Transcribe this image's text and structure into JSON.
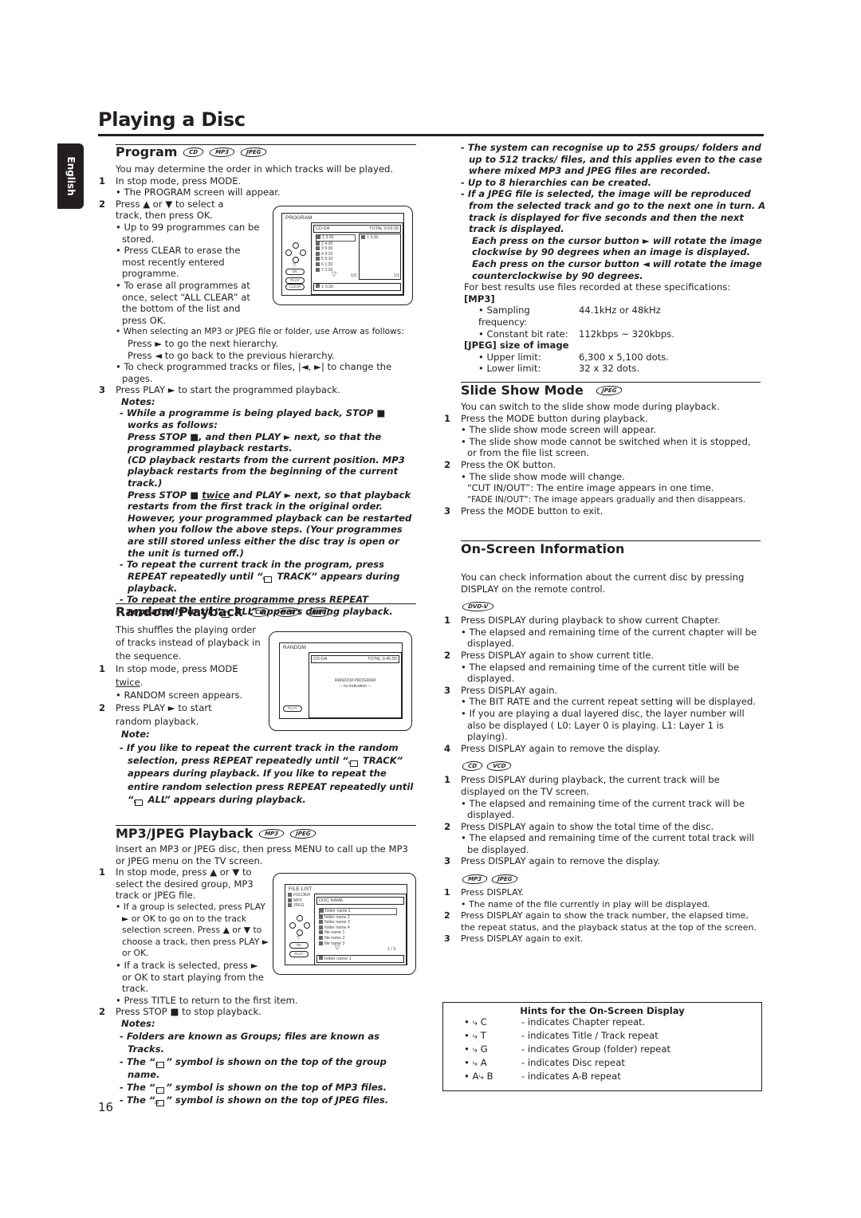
{
  "page": {
    "title": "Playing a Disc",
    "language_tab": "English",
    "page_number": "16"
  },
  "program": {
    "title": "Program",
    "discs": [
      "CD",
      "MP3",
      "JPEG"
    ],
    "intro": "You may determine the order in which tracks will be played.",
    "steps": [
      {
        "n": "1",
        "text": "In stop mode, press MODE."
      },
      {
        "n": "2",
        "text": "Press ▲ or ▼ to select a track, then press OK."
      },
      {
        "n": "3",
        "text": "Press PLAY ► to start the programmed playback."
      }
    ],
    "step1_bullets": [
      "• The PROGRAM screen will appear."
    ],
    "step2_bullets": [
      "• Up to 99 programmes can be stored.",
      "• Press CLEAR to erase the most recently entered programme.",
      "• To erase all programmes at once, select “ALL CLEAR” at the bottom of the list and press OK.",
      "• When selecting an MP3 or JPEG file or folder, use Arrow as follows:",
      "Press ► to go the next hierarchy.",
      "Press ◄ to go back to the previous hierarchy.",
      "• To check programmed tracks or files, |◄, ►| to change the pages."
    ],
    "notes_label": "Notes:",
    "notes": [
      "- While a programme is being played back, STOP ■ works as follows:",
      "Press STOP ■, and then PLAY ► next, so that the programmed playback restarts.",
      "(CD playback restarts from the current position. MP3 playback restarts from the beginning of the current track.)",
      "Press STOP ■",
      "twice",
      "and PLAY ► next, so that playback restarts from the first track in the original order. However, your programmed playback can be restarted when you follow the above steps. (Your programmes are still stored unless either the disc tray is open or the unit is turned off.)",
      "- To repeat the current track in the program, press REPEAT repeatedly until “",
      " TRACK” appears during playback.",
      "- To repeat the entire programme press REPEAT repeatedly until “",
      " ALL” appears during playback."
    ],
    "screen": {
      "label": "PROGRAM",
      "disc_type": "CD-DA",
      "total": "TOTAL  0:03:30",
      "tracks": [
        "1   3:30",
        "2   4:30",
        "3   5:00",
        "4   3:10",
        "5   5:10",
        "6   1:30",
        "7   2:30"
      ],
      "left_page": "1/2",
      "programmed": [
        "1   3:30"
      ],
      "right_page": "1/1",
      "current": "1   3:30",
      "buttons": [
        "OK",
        "PLAY",
        "CLEAR"
      ]
    }
  },
  "random": {
    "title": "Random Playback",
    "discs": [
      "CD",
      "MP3",
      "JPEG"
    ],
    "intro": "This shuffles the playing order of tracks instead of playback in the sequence.",
    "step1": "In stop mode, press MODE",
    "step1_u": "twice",
    "step1_bullet": "• RANDOM screen appears.",
    "step2": "Press PLAY ► to start random playback.",
    "note_label": "Note:",
    "note_parts": [
      "- If you like to repeat the current track in the random selection, press REPEAT repeatedly until “",
      " TRACK” appears during playback. If you like to repeat the entire random selection press REPEAT repeatedly until “",
      " ALL” appears during playback."
    ],
    "screen": {
      "label": "RANDOM",
      "disc_type": "CD-DA",
      "total": "TOTAL  0:45:55",
      "center_title": "RANDOM PROGRAM",
      "center_sub": "-- no indication --",
      "button": "PLAY"
    }
  },
  "mp3jpeg": {
    "title": "MP3/JPEG Playback",
    "discs": [
      "MP3",
      "JPEG"
    ],
    "intro": "Insert an MP3 or JPEG disc, then press MENU to call up the MP3 or JPEG menu on the TV screen.",
    "step1": "In stop mode, press ▲ or ▼ to select the desired group, MP3 track or JPEG file.",
    "step1_bullets": [
      "• If a group is selected, press PLAY ► or OK to go on to the track selection screen. Press ▲ or ▼ to choose a track, then press PLAY ► or OK.",
      "• If a track is selected, press ► or OK to start playing from the track.",
      "• Press TITLE to return to the first item."
    ],
    "step2": "Press STOP ■ to stop playback.",
    "notes_label": "Notes:",
    "notes": [
      "- Folders are known as Groups; files are known as Tracks.",
      "” symbol is shown on the top of the group name.",
      "” symbol is shown on the top of MP3 files.",
      "” symbol is shown on the top of JPEG files."
    ],
    "notes_prefix": "- The “",
    "screen": {
      "label": "FILE LIST",
      "legend": [
        "FOLDER",
        "MP3",
        "JPEG"
      ],
      "disc_name": "DISC NAME",
      "items": [
        "folder name 1",
        "folder name 2",
        "folder name 3",
        "folder name 4",
        "file name 1",
        "file name 2",
        "file name 3"
      ],
      "page": "1 / 3",
      "current": "folder name 1",
      "buttons": [
        "OK",
        "PLAY"
      ]
    }
  },
  "right_notes": [
    "- The system can recognise up to 255 groups/ folders and up to 512 tracks/ files, and this applies even to the case where mixed MP3 and JPEG files are recorded.",
    "- Up to 8 hierarchies can be created.",
    "- If a JPEG file is selected, the image will be reproduced from the selected track and go to the next one in turn. A track is displayed for five seconds and then the next track is displayed.",
    "Each press on the cursor button ► will rotate the image clockwise by 90 degrees when an image is displayed.",
    "Each press on the cursor button ◄ will rotate the image counterclockwise by 90 degrees."
  ],
  "specs": {
    "intro": "For best results use files recorded at these specifications:",
    "mp3_head": "[MP3]",
    "mp3": [
      {
        "k": "• Sampling frequency:",
        "v": "44.1kHz or 48kHz"
      },
      {
        "k": "• Constant bit rate:",
        "v": "112kbps ~ 320kbps."
      }
    ],
    "jpeg_head": "[JPEG] size of image",
    "jpeg": [
      {
        "k": "• Upper limit:",
        "v": "6,300 x 5,100 dots."
      },
      {
        "k": "• Lower limit:",
        "v": "32 x 32 dots."
      }
    ]
  },
  "slideshow": {
    "title": "Slide Show Mode",
    "discs": [
      "JPEG"
    ],
    "intro": "You can switch to the slide show mode during playback.",
    "s1": "Press the MODE button during playback.",
    "s1_b": [
      "• The slide show mode screen will appear.",
      "• The slide show mode cannot be switched when it is stopped, or from the file list screen."
    ],
    "s2": "Press the OK button.",
    "s2_b": [
      "• The slide show mode will change.",
      "“CUT IN/OUT”: The entire image appears in one time.",
      "“FADE IN/OUT”: The image appears gradually and then disappears."
    ],
    "s3": "Press the MODE button to exit."
  },
  "onscreen": {
    "title": "On-Screen Information",
    "intro": "You can check information about the current disc by pressing DISPLAY on the remote control.",
    "dvd": {
      "discs": [
        "DVD-V"
      ],
      "steps": [
        {
          "n": "1",
          "t": "Press DISPLAY during playback to show current Chapter.",
          "b": [
            "• The elapsed and remaining time of the current chapter will be displayed."
          ]
        },
        {
          "n": "2",
          "t": "Press DISPLAY again to show current title.",
          "b": [
            "• The elapsed and remaining time of the current title will be displayed."
          ]
        },
        {
          "n": "3",
          "t": "Press DISPLAY again.",
          "b": [
            "• The BIT RATE and the current repeat setting will be displayed.",
            "• If you are playing a dual layered disc, the layer number will also be displayed ( L0: Layer 0 is playing. L1: Layer 1 is playing)."
          ]
        },
        {
          "n": "4",
          "t": "Press DISPLAY again to remove the display.",
          "b": []
        }
      ]
    },
    "cd": {
      "discs": [
        "CD",
        "VCD"
      ],
      "steps": [
        {
          "n": "1",
          "t": "Press DISPLAY during playback, the current track will be displayed on the TV screen.",
          "b": [
            "• The elapsed and remaining time of the current track will be displayed."
          ]
        },
        {
          "n": "2",
          "t": "Press DISPLAY again to show the total time of the disc.",
          "b": [
            "• The elapsed and remaining time of the current total track will be displayed."
          ]
        },
        {
          "n": "3",
          "t": "Press DISPLAY again to remove the display.",
          "b": []
        }
      ]
    },
    "mp3": {
      "discs": [
        "MP3",
        "JPEG"
      ],
      "steps": [
        {
          "n": "1",
          "t": "Press DISPLAY.",
          "b": [
            "• The name of the file currently in play will be displayed."
          ]
        },
        {
          "n": "2",
          "t": "Press DISPLAY again to show the track number, the elapsed time, the repeat status, and the playback status at the top of the screen.",
          "b": []
        },
        {
          "n": "3",
          "t": "Press DISPLAY again to exit.",
          "b": []
        }
      ]
    },
    "hints": {
      "title": "Hints for the On-Screen Display",
      "items": [
        {
          "sym": "• ⤷ C",
          "desc": "- indicates Chapter repeat."
        },
        {
          "sym": "• ⤷ T",
          "desc": "- indicates Title / Track repeat"
        },
        {
          "sym": "• ⤷ G",
          "desc": "- indicates Group (folder) repeat"
        },
        {
          "sym": "• ⤷ A",
          "desc": "- indicates Disc repeat"
        },
        {
          "sym": "• A⤷ B",
          "desc": "- indicates A-B repeat"
        }
      ]
    }
  }
}
